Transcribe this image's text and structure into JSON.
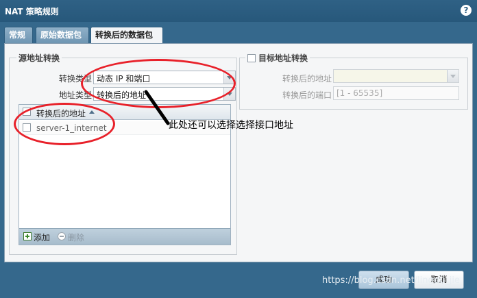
{
  "window": {
    "title": "NAT 策略规则",
    "help_icon": "?"
  },
  "tabs": [
    {
      "label": "常规",
      "active": false
    },
    {
      "label": "原始数据包",
      "active": false
    },
    {
      "label": "转换后的数据包",
      "active": true
    }
  ],
  "source_translation": {
    "legend": "源地址转换",
    "translation_type_label": "转换类型",
    "translation_type_value": "动态 IP 和端口",
    "address_type_label": "地址类型",
    "address_type_value": "转换后的地址",
    "grid": {
      "column_header": "转换后的地址",
      "rows": [
        {
          "value": "server-1_internet",
          "checked": false
        }
      ]
    },
    "toolbar": {
      "add_label": "添加",
      "delete_label": "删除"
    }
  },
  "destination_translation": {
    "legend": "目标地址转换",
    "checked": false,
    "translated_address_label": "转换后的地址",
    "translated_address_value": "",
    "translated_port_label": "转换后的端口",
    "translated_port_placeholder": "[1 - 65535]"
  },
  "annotation": {
    "text": "此处还可以选择选择接口地址",
    "color": "#e8212a"
  },
  "footer": {
    "ok_label": "成功",
    "cancel_label": "取消"
  },
  "watermark": "https://blog.csdn.net/lingdu_jie"
}
